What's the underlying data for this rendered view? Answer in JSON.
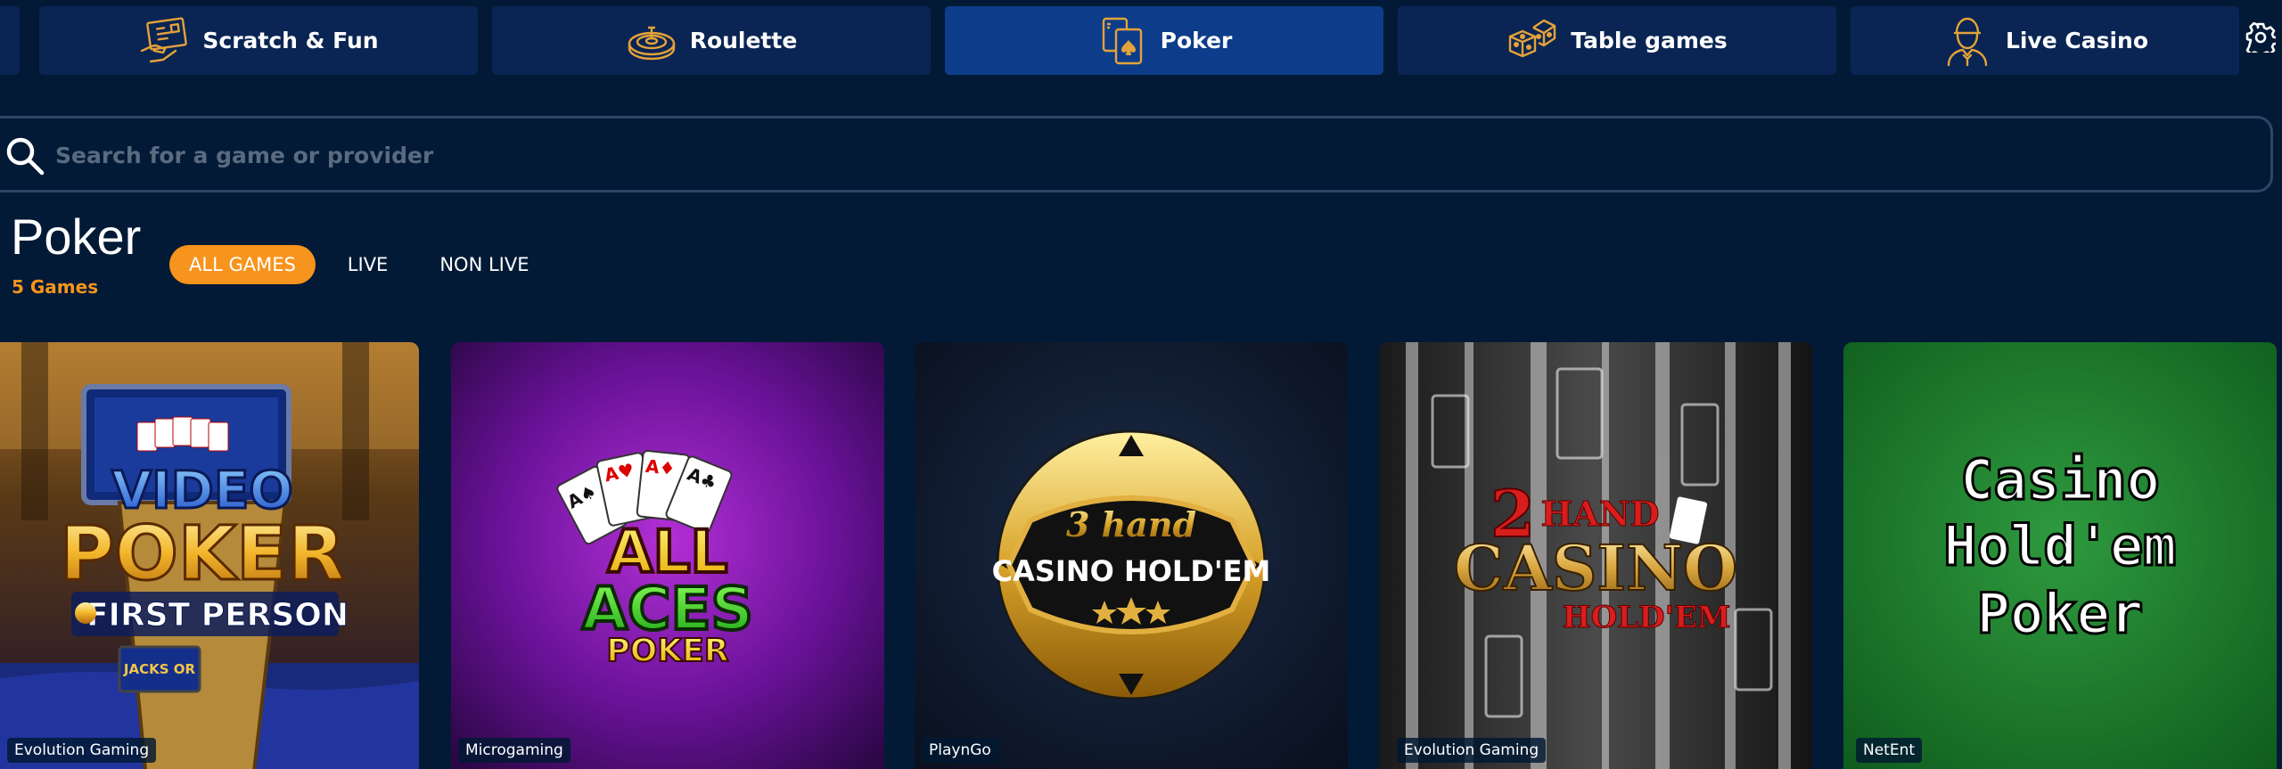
{
  "categories": [
    {
      "label": "Scratch & Fun",
      "icon": "scratch-card-icon"
    },
    {
      "label": "Roulette",
      "icon": "roulette-wheel-icon"
    },
    {
      "label": "Poker",
      "icon": "playing-cards-icon",
      "active": true
    },
    {
      "label": "Table games",
      "icon": "dice-icon"
    },
    {
      "label": "Live Casino",
      "icon": "croupier-icon"
    }
  ],
  "search": {
    "placeholder": "Search for a game or provider",
    "value": ""
  },
  "section": {
    "title": "Poker",
    "count": "5 Games"
  },
  "filters": [
    {
      "label": "ALL GAMES",
      "active": true
    },
    {
      "label": "LIVE",
      "active": false
    },
    {
      "label": "NON LIVE",
      "active": false
    }
  ],
  "games": [
    {
      "art_text": [
        "VIDEO",
        "POKER",
        "FIRST PERSON",
        "JACKS OR"
      ],
      "provider": "Evolution Gaming"
    },
    {
      "art_text": [
        "ALL",
        "ACES",
        "POKER"
      ],
      "provider": "Microgaming"
    },
    {
      "art_text": [
        "3 hand",
        "CASINO HOLD'EM"
      ],
      "provider": "PlaynGo"
    },
    {
      "art_text": [
        "2",
        "HAND",
        "CASINO",
        "HOLD'EM"
      ],
      "provider": "Evolution Gaming"
    },
    {
      "art_text": [
        "Casino",
        "Hold'em",
        "Poker"
      ],
      "provider": "NetEnt"
    }
  ],
  "colors": {
    "background": "#021a36",
    "tab": "#0a2553",
    "tab_active": "#0d3d8a",
    "accent": "#f7941d",
    "icon_gold": "#e4a23a"
  }
}
